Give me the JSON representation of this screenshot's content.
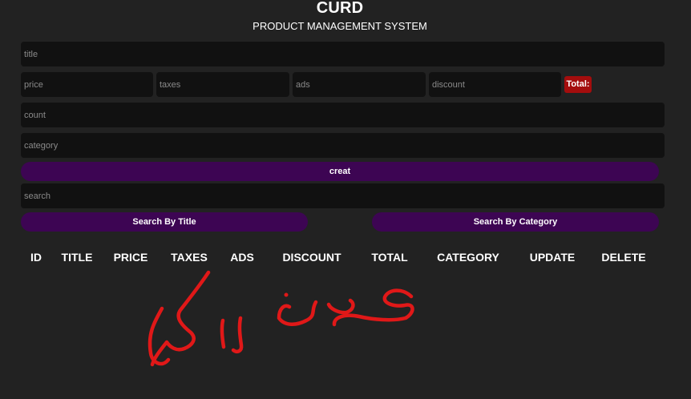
{
  "header": {
    "title": "CURD",
    "subtitle": "PRODUCT MANAGEMENT SYSTEM"
  },
  "form": {
    "title_placeholder": "title",
    "price_placeholder": "price",
    "taxes_placeholder": "taxes",
    "ads_placeholder": "ads",
    "discount_placeholder": "discount",
    "total_label": "Total:",
    "count_placeholder": "count",
    "category_placeholder": "category",
    "create_label": "creat"
  },
  "search": {
    "placeholder": "search",
    "by_title_label": "Search By Title",
    "by_category_label": "Search By Category"
  },
  "table": {
    "columns": [
      "ID",
      "TITLE",
      "PRICE",
      "TAXES",
      "ADS",
      "DISCOUNT",
      "TOTAL",
      "CATEGORY",
      "UPDATE",
      "DELETE"
    ]
  },
  "colors": {
    "background": "#222222",
    "input_background": "#111111",
    "button_purple": "#3d0553",
    "total_red": "#a40d0d",
    "scribble_red": "#e01818"
  },
  "annotation": {
    "handwritten_text": "حذف الكل"
  }
}
